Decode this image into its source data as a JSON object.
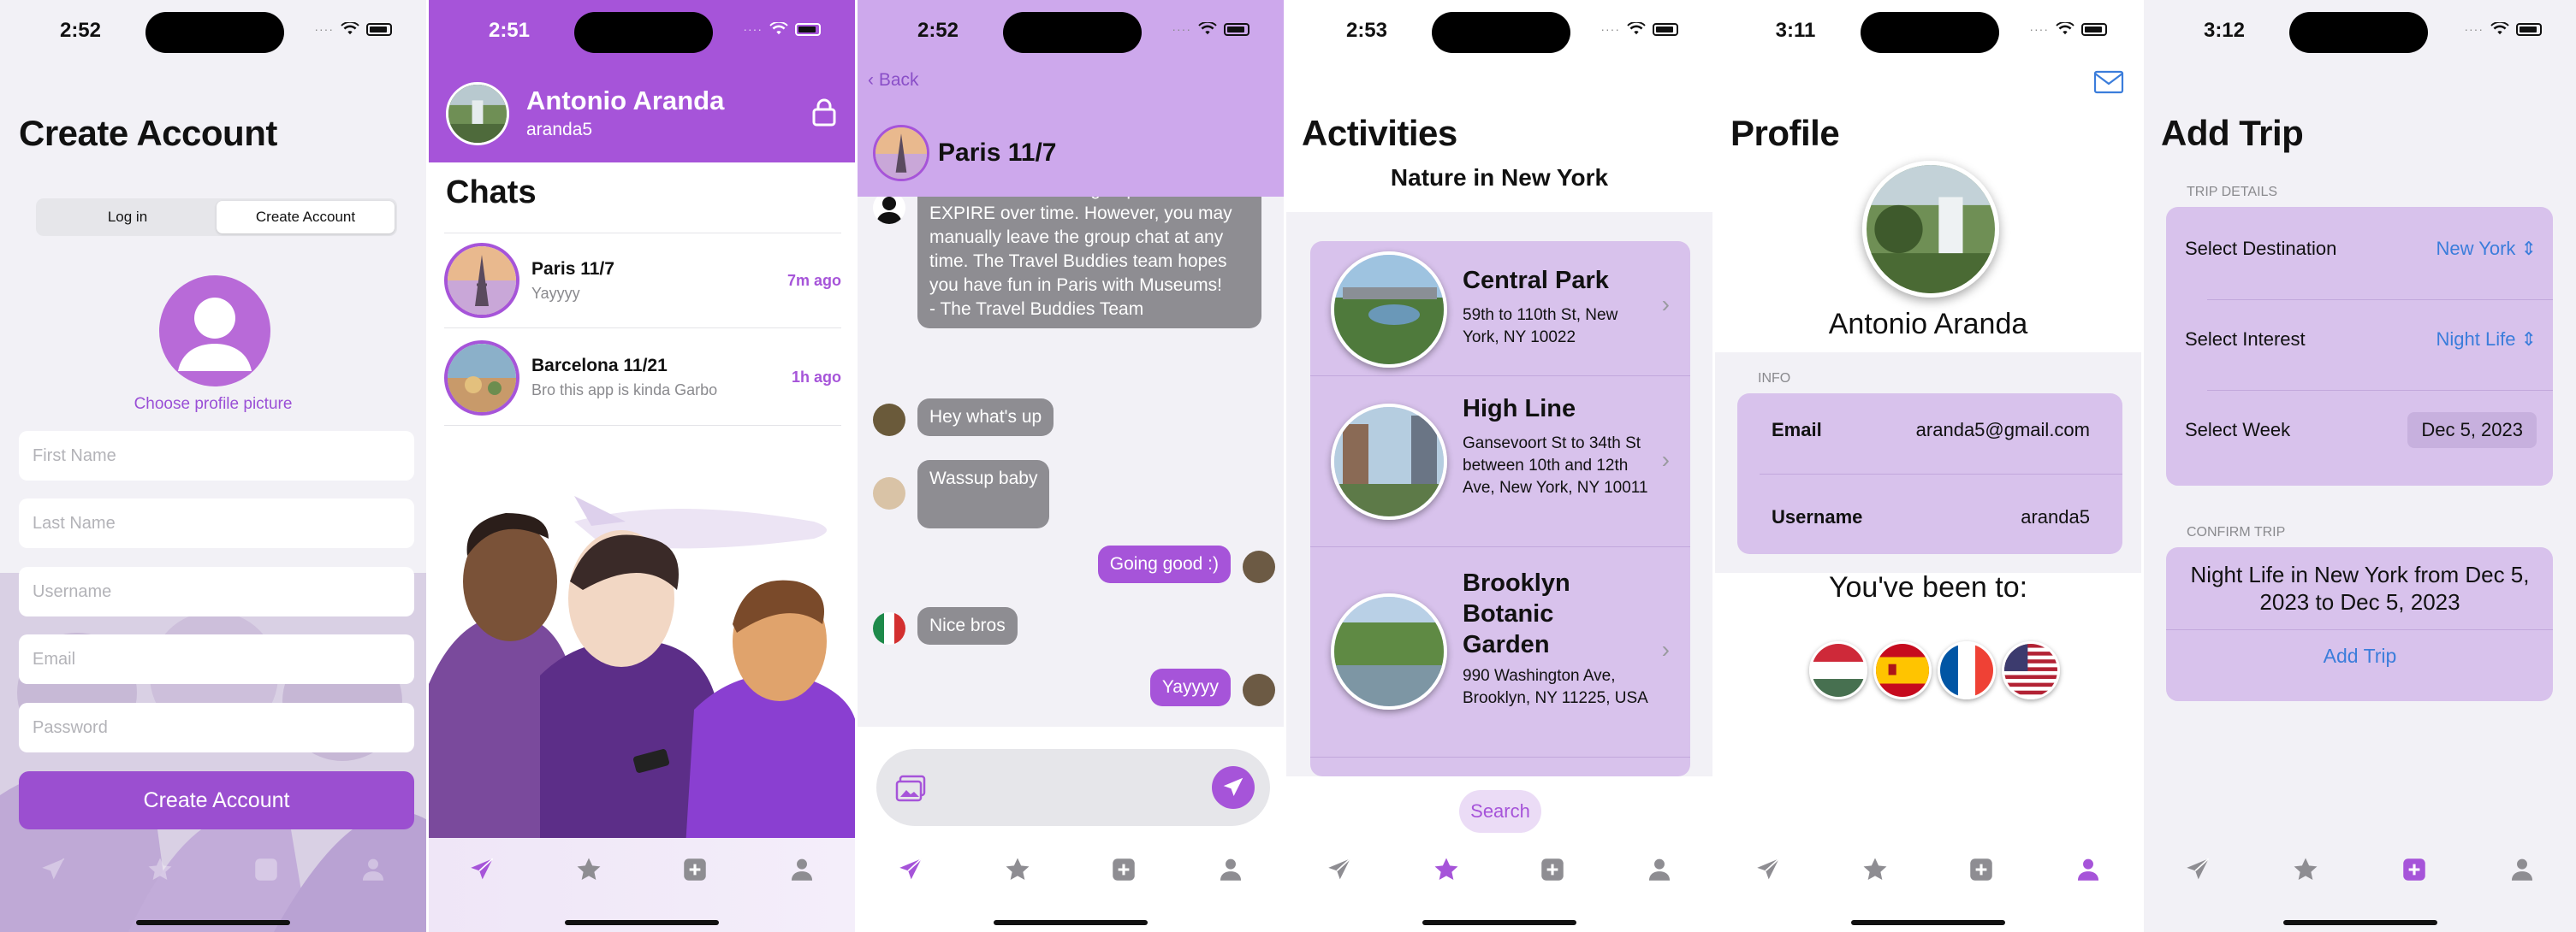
{
  "colors": {
    "accent": "#a654d9",
    "card": "#d8c2ec",
    "link": "#3b7ddb"
  },
  "screens": {
    "create_account": {
      "time": "2:52",
      "title": "Create Account",
      "segments": [
        "Log in",
        "Create Account"
      ],
      "choose_picture": "Choose profile picture",
      "placeholders": [
        "First Name",
        "Last Name",
        "Username",
        "Email",
        "Password"
      ],
      "button": "Create Account"
    },
    "chats": {
      "time": "2:51",
      "user_name": "Antonio Aranda",
      "username": "aranda5",
      "title": "Chats",
      "items": [
        {
          "name": "Paris 11/7",
          "preview": "Yayyyy",
          "time": "7m ago"
        },
        {
          "name": "Barcelona 11/21",
          "preview": "Bro this app is kinda Garbo",
          "time": "1h ago"
        }
      ]
    },
    "conversation": {
      "time": "2:52",
      "back": "Back",
      "group": "Paris 11/7",
      "system_message": "different times! This group chat will NOT EXPIRE over time. However, you may manually leave the group chat at any time. The Travel Buddies team hopes you have fun in Paris with Museums!\n- The Travel Buddies Team",
      "messages": [
        "Hey what's up",
        "Wassup baby",
        "Going good :)",
        "Nice bros",
        "Yayyyy"
      ]
    },
    "activities": {
      "time": "2:53",
      "title": "Activities",
      "subtitle": "Nature in New York",
      "items": [
        {
          "name": "Central Park",
          "address": "59th to 110th St, New York, NY 10022"
        },
        {
          "name": "High Line",
          "address": "Gansevoort St to 34th St between 10th and 12th Ave, New York, NY 10011"
        },
        {
          "name": "Brooklyn Botanic Garden",
          "address": "990 Washington Ave, Brooklyn, NY 11225, USA"
        }
      ],
      "search": "Search"
    },
    "profile": {
      "time": "3:11",
      "title": "Profile",
      "name": "Antonio Aranda",
      "info_header": "INFO",
      "email_label": "Email",
      "email": "aranda5@gmail.com",
      "username_label": "Username",
      "username": "aranda5",
      "been_to": "You've been to:",
      "flags": [
        "hungary-flag",
        "spain-flag",
        "france-flag",
        "usa-flag"
      ]
    },
    "add_trip": {
      "time": "3:12",
      "title": "Add Trip",
      "details_header": "TRIP DETAILS",
      "destination_label": "Select Destination",
      "destination": "New York",
      "interest_label": "Select Interest",
      "interest": "Night Life",
      "week_label": "Select Week",
      "week": "Dec 5, 2023",
      "confirm_header": "CONFIRM TRIP",
      "summary": "Night Life in New York from Dec 5, 2023 to Dec 5, 2023",
      "add_button": "Add Trip"
    }
  },
  "tabs": [
    "send-icon",
    "star-icon",
    "plus-square-icon",
    "person-icon"
  ]
}
